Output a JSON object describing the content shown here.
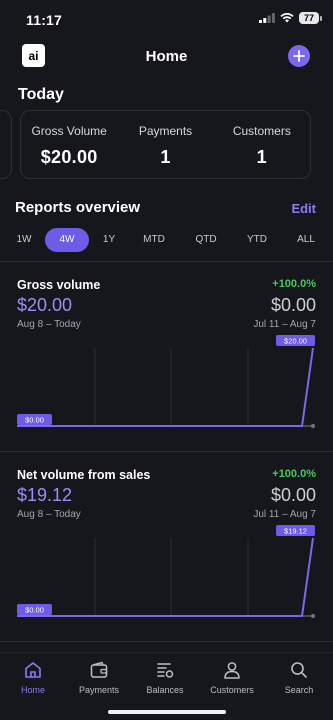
{
  "status_bar": {
    "time": "11:17",
    "battery": "77"
  },
  "header": {
    "title": "Home",
    "logo_text": "ai"
  },
  "today": {
    "heading": "Today",
    "metrics": [
      {
        "label": "Gross Volume",
        "value": "$20.00"
      },
      {
        "label": "Payments",
        "value": "1"
      },
      {
        "label": "Customers",
        "value": "1"
      }
    ]
  },
  "reports": {
    "heading": "Reports overview",
    "edit_label": "Edit",
    "tabs": [
      "1W",
      "4W",
      "1Y",
      "MTD",
      "QTD",
      "YTD",
      "ALL"
    ],
    "active_tab": "4W"
  },
  "charts": [
    {
      "title": "Gross volume",
      "change": "+100.0%",
      "current_value": "$20.00",
      "previous_value": "$0.00",
      "current_range": "Aug 8 – Today",
      "previous_range": "Jul 11 – Aug 7",
      "start_label": "$0.00",
      "end_label": "$20.00"
    },
    {
      "title": "Net volume from sales",
      "change": "+100.0%",
      "current_value": "$19.12",
      "previous_value": "$0.00",
      "current_range": "Aug 8 – Today",
      "previous_range": "Jul 11 – Aug 7",
      "start_label": "$0.00",
      "end_label": "$19.12"
    }
  ],
  "chart_data": [
    {
      "type": "line",
      "title": "Gross volume",
      "series": [
        {
          "values": [
            0,
            0,
            0,
            0,
            0,
            0,
            0,
            0,
            0,
            0,
            0,
            0,
            0,
            0,
            0,
            0,
            0,
            0,
            0,
            0,
            0,
            0,
            0,
            0,
            0,
            0,
            0,
            20
          ]
        },
        {
          "values": [
            0,
            0,
            0,
            0,
            0,
            0,
            0,
            0,
            0,
            0,
            0,
            0,
            0,
            0,
            0,
            0,
            0,
            0,
            0,
            0,
            0,
            0,
            0,
            0,
            0,
            0,
            0,
            0
          ]
        }
      ],
      "ylim": [
        0,
        20
      ]
    },
    {
      "type": "line",
      "title": "Net volume from sales",
      "series": [
        {
          "values": [
            0,
            0,
            0,
            0,
            0,
            0,
            0,
            0,
            0,
            0,
            0,
            0,
            0,
            0,
            0,
            0,
            0,
            0,
            0,
            0,
            0,
            0,
            0,
            0,
            0,
            0,
            0,
            19.12
          ]
        },
        {
          "values": [
            0,
            0,
            0,
            0,
            0,
            0,
            0,
            0,
            0,
            0,
            0,
            0,
            0,
            0,
            0,
            0,
            0,
            0,
            0,
            0,
            0,
            0,
            0,
            0,
            0,
            0,
            0,
            0
          ]
        }
      ],
      "ylim": [
        0,
        19.12
      ]
    }
  ],
  "nav": [
    {
      "label": "Home",
      "icon": "home-icon"
    },
    {
      "label": "Payments",
      "icon": "wallet-icon"
    },
    {
      "label": "Balances",
      "icon": "balances-icon"
    },
    {
      "label": "Customers",
      "icon": "person-icon"
    },
    {
      "label": "Search",
      "icon": "search-icon"
    }
  ],
  "colors": {
    "accent": "#7b68ee",
    "positive": "#47c95e",
    "background": "#16161d"
  }
}
